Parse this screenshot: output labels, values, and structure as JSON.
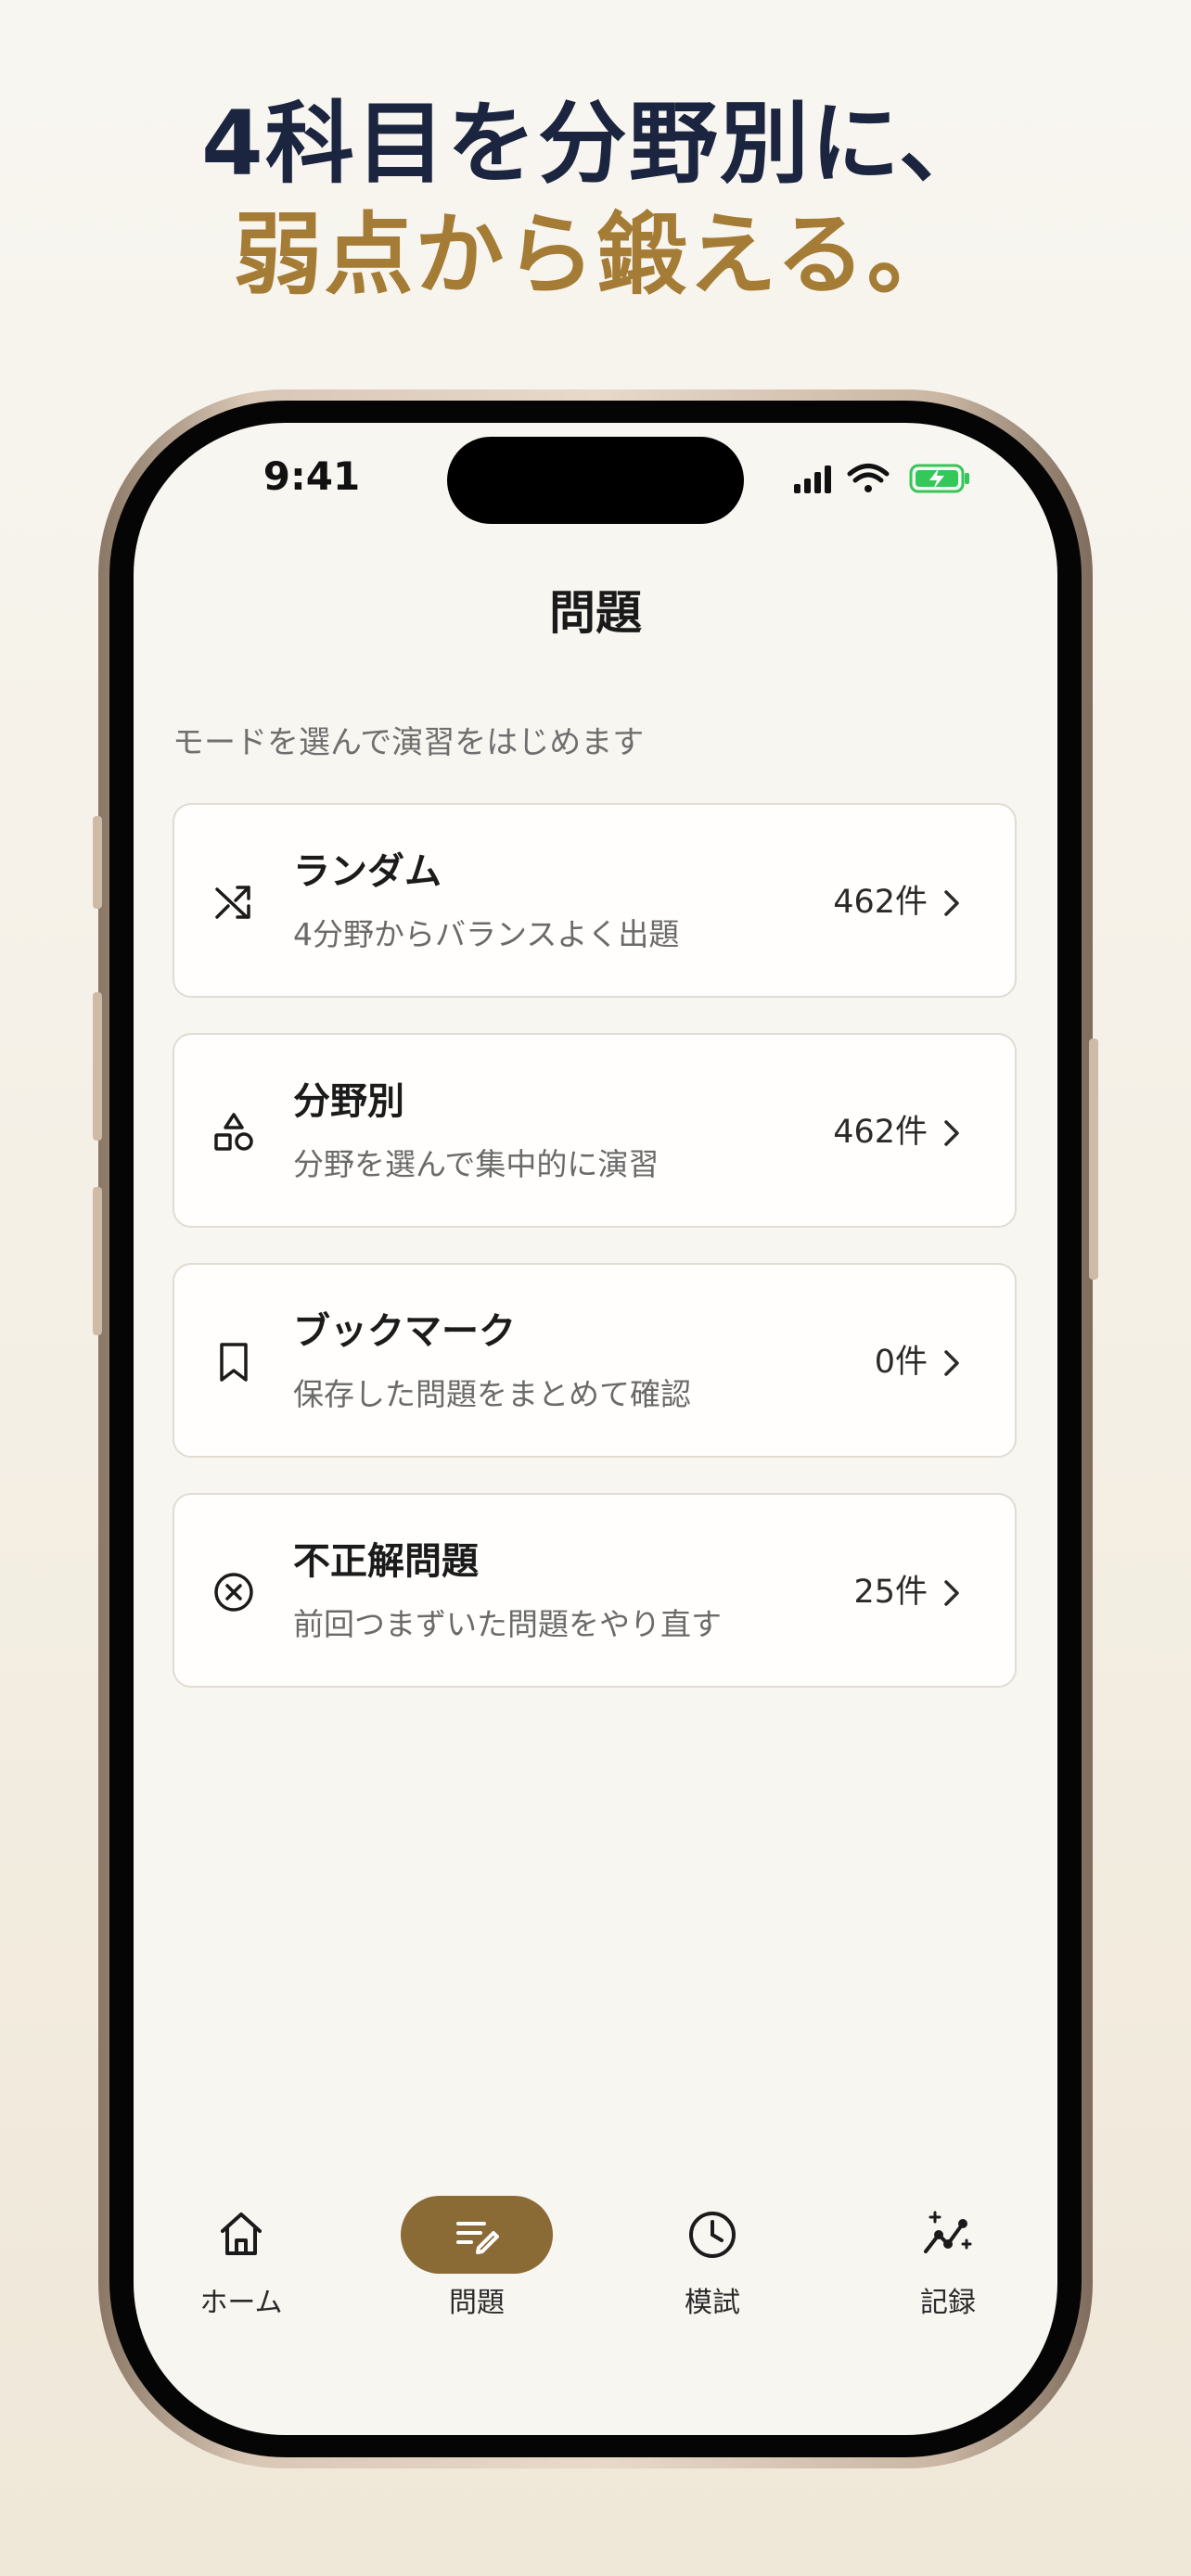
{
  "headline": {
    "line1": "4科目を分野別に、",
    "line2": "弱点から鍛える。"
  },
  "status_bar": {
    "time": "9:41"
  },
  "screen": {
    "title": "問題",
    "subtitle": "モードを選んで演習をはじめます"
  },
  "modes": [
    {
      "title": "ランダム",
      "description": "4分野からバランスよく出題",
      "count": "462件",
      "icon": "shuffle-icon"
    },
    {
      "title": "分野別",
      "description": "分野を選んで集中的に演習",
      "count": "462件",
      "icon": "shapes-icon"
    },
    {
      "title": "ブックマーク",
      "description": "保存した問題をまとめて確認",
      "count": "0件",
      "icon": "bookmark-icon"
    },
    {
      "title": "不正解問題",
      "description": "前回つまずいた問題をやり直す",
      "count": "25件",
      "icon": "x-circle-icon"
    }
  ],
  "tabbar": {
    "items": [
      {
        "label": "ホーム",
        "icon": "home-icon"
      },
      {
        "label": "問題",
        "icon": "edit-list-icon",
        "active": true
      },
      {
        "label": "模試",
        "icon": "clock-icon"
      },
      {
        "label": "記録",
        "icon": "chart-sparkle-icon"
      }
    ]
  },
  "colors": {
    "navy": "#1c2540",
    "gold": "#a57c35",
    "active_pill": "#8a6a35",
    "battery_green": "#34c759"
  }
}
